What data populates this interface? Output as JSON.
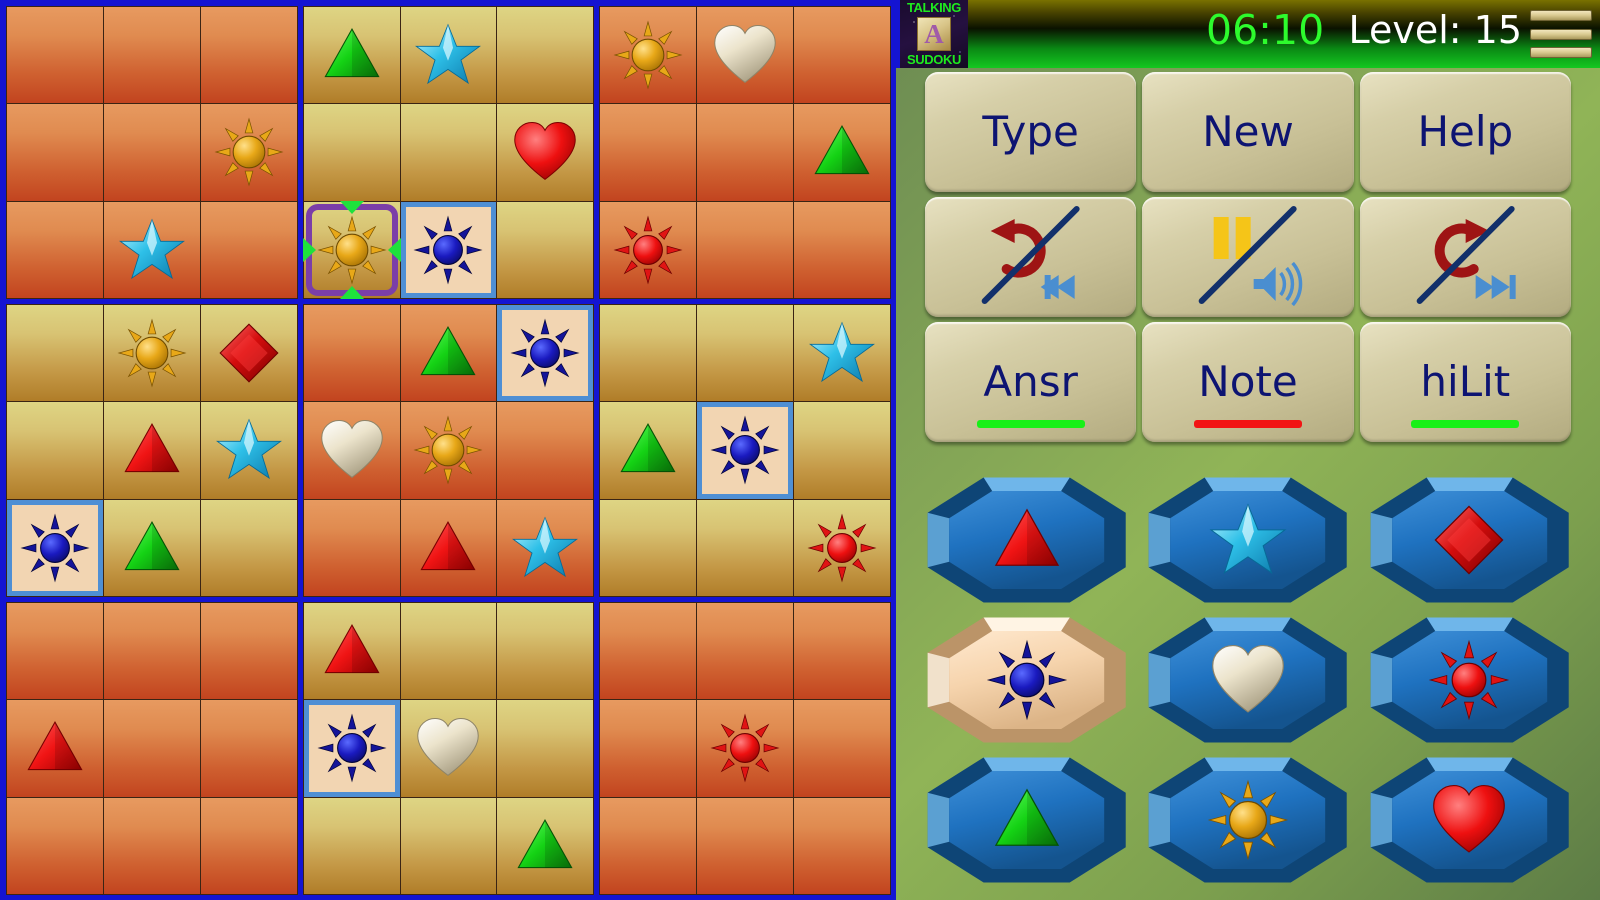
{
  "app": {
    "logo_top": "TALKING",
    "logo_letter": "A",
    "logo_bottom": "SUDOKU",
    "timer": "06:10",
    "level": "Level: 15",
    "accent_green": "#2dfb2d",
    "accent_blue_border": "#1414d2",
    "cell_orange": "#e08b50",
    "cell_tan": "#d8c373",
    "button_face": "#d6cfa8",
    "button_text": "#0d1472",
    "highlight_fill": "#f2d5b2",
    "highlight_frame": "#4f8fd4",
    "cursor_frame": "#7b3ea8",
    "cursor_arrow": "#1ee23c"
  },
  "menu": {
    "icon": "hamburger-menu-icon",
    "bars": 3
  },
  "toolbar": {
    "rows": [
      [
        {
          "label": "Type",
          "name": "type-button",
          "icon": null,
          "underline": null
        },
        {
          "label": "New",
          "name": "new-button",
          "icon": null,
          "underline": null
        },
        {
          "label": "Help",
          "name": "help-button",
          "icon": null,
          "underline": null
        }
      ],
      [
        {
          "label": "",
          "name": "undo-button",
          "icon": "undo-arrow-slash-rewind-icon",
          "underline": null
        },
        {
          "label": "",
          "name": "pause-button",
          "icon": "pause-slash-speaker-icon",
          "underline": null
        },
        {
          "label": "",
          "name": "redo-button",
          "icon": "redo-arrow-slash-fastforward-icon",
          "underline": null
        }
      ],
      [
        {
          "label": "Ansr",
          "name": "answer-button",
          "icon": null,
          "underline": "green"
        },
        {
          "label": "Note",
          "name": "note-button",
          "icon": null,
          "underline": "red"
        },
        {
          "label": "hiLit",
          "name": "hilit-button",
          "icon": null,
          "underline": "green"
        }
      ]
    ]
  },
  "palette": {
    "selected_index": 3,
    "items": [
      {
        "symbol": "red-triangle",
        "name": "palette-red-triangle",
        "selected": false
      },
      {
        "symbol": "cyan-star",
        "name": "palette-cyan-star",
        "selected": false
      },
      {
        "symbol": "red-diamond",
        "name": "palette-red-diamond",
        "selected": false
      },
      {
        "symbol": "blue-sunburst",
        "name": "palette-blue-sunburst",
        "selected": true
      },
      {
        "symbol": "white-heart",
        "name": "palette-white-heart",
        "selected": false
      },
      {
        "symbol": "red-sunburst",
        "name": "palette-red-sunburst",
        "selected": false
      },
      {
        "symbol": "green-triangle",
        "name": "palette-green-triangle",
        "selected": false
      },
      {
        "symbol": "orange-sun",
        "name": "palette-orange-sun",
        "selected": false
      },
      {
        "symbol": "red-heart",
        "name": "palette-red-heart",
        "selected": false
      }
    ]
  },
  "board": {
    "size": 9,
    "box_colors": [
      "orange",
      "tan",
      "orange",
      "tan",
      "orange",
      "tan",
      "orange",
      "tan",
      "orange"
    ],
    "cursor": {
      "row": 2,
      "col": 3
    },
    "cells": [
      [
        {
          "s": null
        },
        {
          "s": null
        },
        {
          "s": null
        },
        {
          "s": "green-triangle"
        },
        {
          "s": "cyan-star"
        },
        {
          "s": null
        },
        {
          "s": "orange-sun"
        },
        {
          "s": "white-heart"
        },
        {
          "s": null
        }
      ],
      [
        {
          "s": null
        },
        {
          "s": null
        },
        {
          "s": "orange-sun"
        },
        {
          "s": null
        },
        {
          "s": null
        },
        {
          "s": "red-heart"
        },
        {
          "s": null
        },
        {
          "s": null
        },
        {
          "s": "green-triangle"
        }
      ],
      [
        {
          "s": null
        },
        {
          "s": "cyan-star"
        },
        {
          "s": null
        },
        {
          "s": "orange-sun",
          "cursor": true
        },
        {
          "s": "blue-sunburst",
          "hilit": true
        },
        {
          "s": null
        },
        {
          "s": "red-sunburst"
        },
        {
          "s": null
        },
        {
          "s": null
        }
      ],
      [
        {
          "s": null
        },
        {
          "s": "orange-sun"
        },
        {
          "s": "red-diamond"
        },
        {
          "s": null
        },
        {
          "s": "green-triangle"
        },
        {
          "s": "blue-sunburst",
          "hilit": true
        },
        {
          "s": null
        },
        {
          "s": null
        },
        {
          "s": "cyan-star"
        }
      ],
      [
        {
          "s": null
        },
        {
          "s": "red-triangle"
        },
        {
          "s": "cyan-star"
        },
        {
          "s": "white-heart"
        },
        {
          "s": "orange-sun"
        },
        {
          "s": null
        },
        {
          "s": "green-triangle"
        },
        {
          "s": "blue-sunburst",
          "hilit": true
        },
        {
          "s": null
        }
      ],
      [
        {
          "s": "blue-sunburst",
          "hilit": true
        },
        {
          "s": "green-triangle"
        },
        {
          "s": null
        },
        {
          "s": null
        },
        {
          "s": "red-triangle"
        },
        {
          "s": "cyan-star"
        },
        {
          "s": null
        },
        {
          "s": null
        },
        {
          "s": "red-sunburst"
        }
      ],
      [
        {
          "s": null
        },
        {
          "s": null
        },
        {
          "s": null
        },
        {
          "s": "red-triangle"
        },
        {
          "s": null
        },
        {
          "s": null
        },
        {
          "s": null
        },
        {
          "s": null
        },
        {
          "s": null
        }
      ],
      [
        {
          "s": "red-triangle"
        },
        {
          "s": null
        },
        {
          "s": null
        },
        {
          "s": "blue-sunburst",
          "hilit": true
        },
        {
          "s": "white-heart"
        },
        {
          "s": null
        },
        {
          "s": null
        },
        {
          "s": "red-sunburst"
        },
        {
          "s": null
        }
      ],
      [
        {
          "s": null
        },
        {
          "s": null
        },
        {
          "s": null
        },
        {
          "s": null
        },
        {
          "s": null
        },
        {
          "s": "green-triangle"
        },
        {
          "s": null
        },
        {
          "s": null
        },
        {
          "s": null
        }
      ]
    ]
  }
}
